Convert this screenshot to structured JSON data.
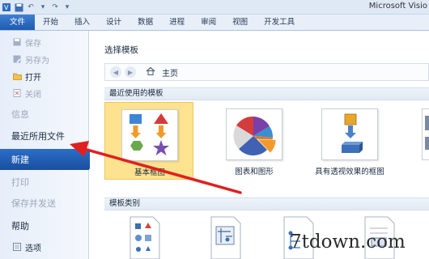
{
  "window": {
    "title": "Microsoft Visio"
  },
  "ribbon": {
    "tabs": [
      "文件",
      "开始",
      "插入",
      "设计",
      "数据",
      "进程",
      "审阅",
      "视图",
      "开发工具"
    ]
  },
  "sidebar": {
    "items": [
      {
        "label": "保存",
        "icon": "save-icon"
      },
      {
        "label": "另存为",
        "icon": "save-as-icon"
      },
      {
        "label": "打开",
        "icon": "open-folder-icon"
      },
      {
        "label": "关闭",
        "icon": "close-doc-icon"
      },
      {
        "label": "信息"
      },
      {
        "label": "最近所用文件"
      },
      {
        "label": "新建"
      },
      {
        "label": "打印"
      },
      {
        "label": "保存并发送"
      },
      {
        "label": "帮助"
      },
      {
        "label": "选项",
        "icon": "options-icon"
      }
    ]
  },
  "content": {
    "heading": "选择模板",
    "breadcrumb": "主页",
    "recent_section": "最近使用的模板",
    "category_section": "模板类别",
    "templates": [
      {
        "label": "基本框图",
        "selected": true
      },
      {
        "label": "图表和图形",
        "selected": false
      },
      {
        "label": "具有透视效果的框图",
        "selected": false
      }
    ]
  },
  "watermark": "7tdown.com",
  "colors": {
    "file_tab": "#1f5bb0",
    "selected_menu": "#2a6ec9",
    "selected_tile": "#fde38f",
    "annotation_arrow": "#e02020"
  }
}
